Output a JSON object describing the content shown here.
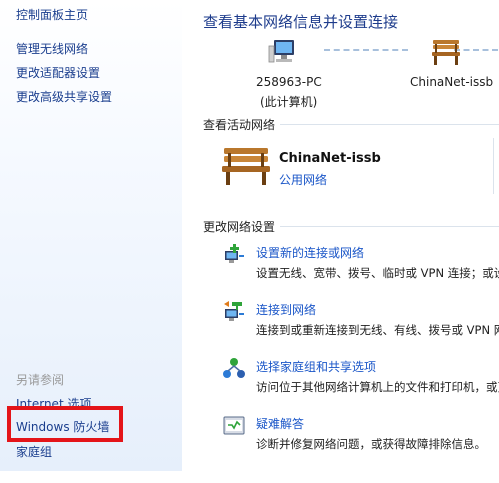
{
  "sidebar": {
    "home": "控制面板主页",
    "links": [
      "管理无线网络",
      "更改适配器设置",
      "更改高级共享设置"
    ],
    "see_also_heading": "另请参阅",
    "see_also": [
      "Internet 选项",
      "Windows 防火墙",
      "家庭组"
    ]
  },
  "main": {
    "title": "查看基本网络信息并设置连接",
    "map": {
      "computer_name": "258963-PC",
      "computer_sub": "(此计算机)",
      "network_name": "ChinaNet-issb"
    },
    "active_section": "查看活动网络",
    "active_network": {
      "name": "ChinaNet-issb",
      "type": "公用网络"
    },
    "change_section": "更改网络设置",
    "tasks": [
      {
        "icon": "setup-connection-icon",
        "title": "设置新的连接或网络",
        "desc": "设置无线、宽带、拨号、临时或 VPN 连接；或设"
      },
      {
        "icon": "connect-network-icon",
        "title": "连接到网络",
        "desc": "连接到或重新连接到无线、有线、拨号或 VPN 网"
      },
      {
        "icon": "homegroup-icon",
        "title": "选择家庭组和共享选项",
        "desc": "访问位于其他网络计算机上的文件和打印机，或更"
      },
      {
        "icon": "troubleshoot-icon",
        "title": "疑难解答",
        "desc": "诊断并修复网络问题，或获得故障排除信息。"
      }
    ]
  },
  "colors": {
    "link": "#1a56c8",
    "title": "#1e3c8c",
    "highlight": "#e41419"
  }
}
